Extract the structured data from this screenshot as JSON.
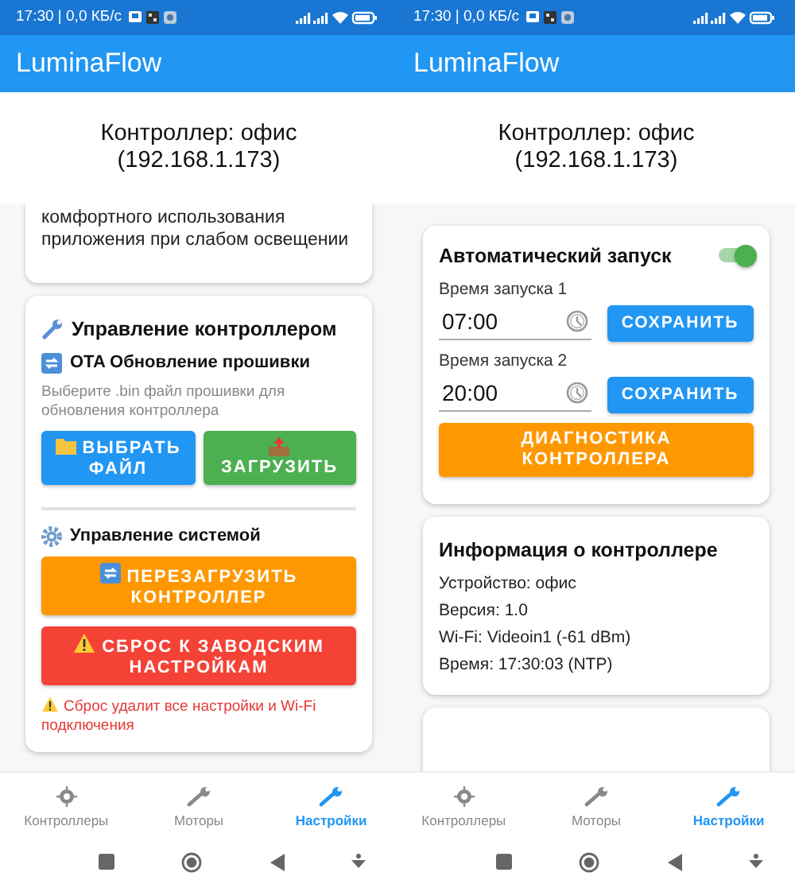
{
  "screens": [
    {
      "status_bar": {
        "text": "17:30 | 0,0 КБ/с"
      },
      "app_title": "LuminaFlow",
      "header": {
        "title": "Контроллер: офис",
        "address": "(192.168.1.173)"
      },
      "cards": [
        {
          "kind": "cut",
          "blocks": [
            {
              "kind": "text",
              "text": "комфортного использования приложения при слабом освещении"
            }
          ]
        },
        {
          "kind": "full",
          "blocks": [
            {
              "kind": "tool_title",
              "text": "Управление контроллером"
            },
            {
              "kind": "update_title",
              "text": "OTA Обновление прошивки"
            },
            {
              "kind": "hint",
              "text": "Выберите .bin файл прошивки для обновления контроллера"
            },
            {
              "kind": "buttons",
              "items": [
                {
                  "kind": "folder",
                  "label": "ВЫБРАТЬ ФАЙЛ",
                  "color": "#2196f3"
                },
                {
                  "kind": "upload",
                  "label": "ЗАГРУЗИТЬ",
                  "color": "#4caf50"
                }
              ]
            },
            {
              "kind": "divider"
            },
            {
              "kind": "system_title",
              "text": "Управление системой"
            },
            {
              "kind": "button",
              "item": {
                "kind": "refresh",
                "label": "ПЕРЕЗАГРУЗИТЬ КОНТРОЛЛЕР",
                "color": "#ff9800"
              }
            },
            {
              "kind": "button",
              "item": {
                "kind": "warning",
                "label": "СБРОС К ЗАВОДСКИМ НАСТРОЙКАМ",
                "color": "#f44336"
              }
            },
            {
              "kind": "warning_note",
              "text": "Сброс удалит все настройки и Wi-Fi подключения"
            }
          ]
        }
      ],
      "nav": [
        {
          "kind": "crosshair",
          "label": "Контроллеры",
          "selected": false
        },
        {
          "kind": "wrench",
          "label": "Моторы",
          "selected": false
        },
        {
          "kind": "wrench",
          "label": "Настройки",
          "selected": true
        }
      ]
    },
    {
      "status_bar": {
        "text": "17:30 | 0,0 КБ/с"
      },
      "app_title": "LuminaFlow",
      "header": {
        "title": "Контроллер: офис",
        "address": "(192.168.1.173)"
      },
      "cards": [
        {
          "kind": "full",
          "blocks": [
            {
              "kind": "toggle_title",
              "text": "Автоматический запуск",
              "on": true
            },
            {
              "kind": "time_field",
              "label": "Время запуска 1",
              "value": "07:00",
              "button": "СОХРАНИТЬ"
            },
            {
              "kind": "time_field",
              "label": "Время запуска 2",
              "value": "20:00",
              "button": "СОХРАНИТЬ"
            },
            {
              "kind": "button",
              "item": {
                "kind": "plain",
                "label": "ДИАГНОСТИКА КОНТРОЛЛЕРА",
                "color": "#ff9800"
              }
            }
          ]
        },
        {
          "kind": "full",
          "blocks": [
            {
              "kind": "title",
              "text": "Информация о контроллере"
            },
            {
              "kind": "info",
              "text": "Устройство: офис"
            },
            {
              "kind": "info",
              "text": "Версия: 1.0"
            },
            {
              "kind": "info",
              "text": "Wi-Fi: Videoin1 (-61 dBm)"
            },
            {
              "kind": "info",
              "text": "Время: 17:30:03 (NTP)"
            }
          ]
        },
        {
          "kind": "full"
        }
      ],
      "nav": [
        {
          "kind": "crosshair",
          "label": "Контроллеры",
          "selected": false
        },
        {
          "kind": "wrench",
          "label": "Моторы",
          "selected": false
        },
        {
          "kind": "wrench",
          "label": "Настройки",
          "selected": true
        }
      ]
    }
  ]
}
